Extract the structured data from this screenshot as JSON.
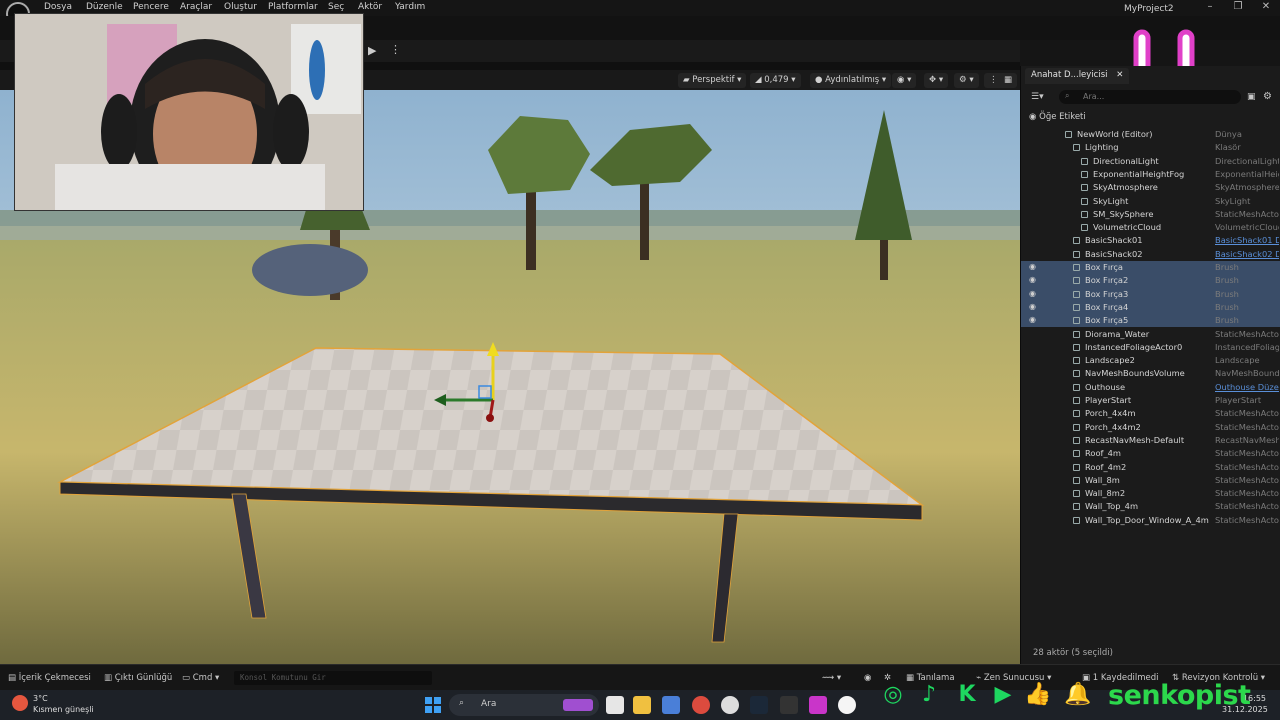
{
  "menu": {
    "items": [
      "Dosya",
      "Düzenle",
      "Pencere",
      "Araçlar",
      "Oluştur",
      "Platformlar",
      "Seç",
      "Aktör",
      "Yardım"
    ],
    "project_name": "MyProject2"
  },
  "viewport": {
    "perspective_label": "Perspektif",
    "scale_value": "0,479",
    "lit_label": "Aydınlatılmış"
  },
  "outliner": {
    "tab_title": "Anahat D...leyicisi",
    "search_placeholder": "Ara...",
    "column_label": "Öğe Etiketi",
    "rows": [
      {
        "label": "NewWorld (Editor)",
        "type": "Dünya",
        "indent": 0,
        "link": false,
        "selected": false,
        "eye": false
      },
      {
        "label": "Lighting",
        "type": "Klasör",
        "indent": 1,
        "link": false,
        "selected": false,
        "eye": false
      },
      {
        "label": "DirectionalLight",
        "type": "DirectionalLight",
        "indent": 2,
        "link": false,
        "selected": false,
        "eye": false
      },
      {
        "label": "ExponentialHeightFog",
        "type": "ExponentialHeigh",
        "indent": 2,
        "link": false,
        "selected": false,
        "eye": false
      },
      {
        "label": "SkyAtmosphere",
        "type": "SkyAtmosphere",
        "indent": 2,
        "link": false,
        "selected": false,
        "eye": false
      },
      {
        "label": "SkyLight",
        "type": "SkyLight",
        "indent": 2,
        "link": false,
        "selected": false,
        "eye": false
      },
      {
        "label": "SM_SkySphere",
        "type": "StaticMeshActor",
        "indent": 2,
        "link": false,
        "selected": false,
        "eye": false
      },
      {
        "label": "VolumetricCloud",
        "type": "VolumetricCloud",
        "indent": 2,
        "link": false,
        "selected": false,
        "eye": false
      },
      {
        "label": "BasicShack01",
        "type": "BasicShack01 D",
        "indent": 1,
        "link": true,
        "selected": false,
        "eye": false
      },
      {
        "label": "BasicShack02",
        "type": "BasicShack02 D",
        "indent": 1,
        "link": true,
        "selected": false,
        "eye": false
      },
      {
        "label": "Box Fırça",
        "type": "Brush",
        "indent": 1,
        "link": false,
        "selected": true,
        "eye": true
      },
      {
        "label": "Box Fırça2",
        "type": "Brush",
        "indent": 1,
        "link": false,
        "selected": true,
        "eye": true
      },
      {
        "label": "Box Fırça3",
        "type": "Brush",
        "indent": 1,
        "link": false,
        "selected": true,
        "eye": true
      },
      {
        "label": "Box Fırça4",
        "type": "Brush",
        "indent": 1,
        "link": false,
        "selected": true,
        "eye": true
      },
      {
        "label": "Box Fırça5",
        "type": "Brush",
        "indent": 1,
        "link": false,
        "selected": true,
        "eye": true
      },
      {
        "label": "Diorama_Water",
        "type": "StaticMeshActor",
        "indent": 1,
        "link": false,
        "selected": false,
        "eye": false
      },
      {
        "label": "InstancedFoliageActor0",
        "type": "InstancedFoliage",
        "indent": 1,
        "link": false,
        "selected": false,
        "eye": false
      },
      {
        "label": "Landscape2",
        "type": "Landscape",
        "indent": 1,
        "link": false,
        "selected": false,
        "eye": false
      },
      {
        "label": "NavMeshBoundsVolume",
        "type": "NavMeshBounds",
        "indent": 1,
        "link": false,
        "selected": false,
        "eye": false
      },
      {
        "label": "Outhouse",
        "type": "Outhouse Düzen",
        "indent": 1,
        "link": true,
        "selected": false,
        "eye": false
      },
      {
        "label": "PlayerStart",
        "type": "PlayerStart",
        "indent": 1,
        "link": false,
        "selected": false,
        "eye": false
      },
      {
        "label": "Porch_4x4m",
        "type": "StaticMeshActor",
        "indent": 1,
        "link": false,
        "selected": false,
        "eye": false
      },
      {
        "label": "Porch_4x4m2",
        "type": "StaticMeshActor",
        "indent": 1,
        "link": false,
        "selected": false,
        "eye": false
      },
      {
        "label": "RecastNavMesh-Default",
        "type": "RecastNavMesh",
        "indent": 1,
        "link": false,
        "selected": false,
        "eye": false
      },
      {
        "label": "Roof_4m",
        "type": "StaticMeshActor",
        "indent": 1,
        "link": false,
        "selected": false,
        "eye": false
      },
      {
        "label": "Roof_4m2",
        "type": "StaticMeshActor",
        "indent": 1,
        "link": false,
        "selected": false,
        "eye": false
      },
      {
        "label": "Wall_8m",
        "type": "StaticMeshActor",
        "indent": 1,
        "link": false,
        "selected": false,
        "eye": false
      },
      {
        "label": "Wall_8m2",
        "type": "StaticMeshActor",
        "indent": 1,
        "link": false,
        "selected": false,
        "eye": false
      },
      {
        "label": "Wall_Top_4m",
        "type": "StaticMeshActor",
        "indent": 1,
        "link": false,
        "selected": false,
        "eye": false
      },
      {
        "label": "Wall_Top_Door_Window_A_4m",
        "type": "StaticMeshActor",
        "indent": 1,
        "link": false,
        "selected": false,
        "eye": false
      }
    ],
    "footer": "28 aktör (5 seçildi)"
  },
  "bottombar": {
    "content_drawer": "İçerik Çekmecesi",
    "output_log": "Çıktı Günlüğü",
    "cmd": "Cmd",
    "console_placeholder": "Konsol Komutunu Gir",
    "derived_data": "Tanılama",
    "zen": "Zen Sunucusu",
    "saved": "1 Kaydedilmedi",
    "revision": "Revizyon Kontrolü"
  },
  "taskbar": {
    "temperature": "3°C",
    "weather": "Kısmen güneşli",
    "search": "Ara",
    "time": "16:55",
    "date": "31.12.2025"
  },
  "overlay": {
    "brand": "senkopist"
  },
  "colors": {
    "accent_green": "#2cd84c",
    "selection": "#3a4d68",
    "smiley": "#e040c8"
  }
}
